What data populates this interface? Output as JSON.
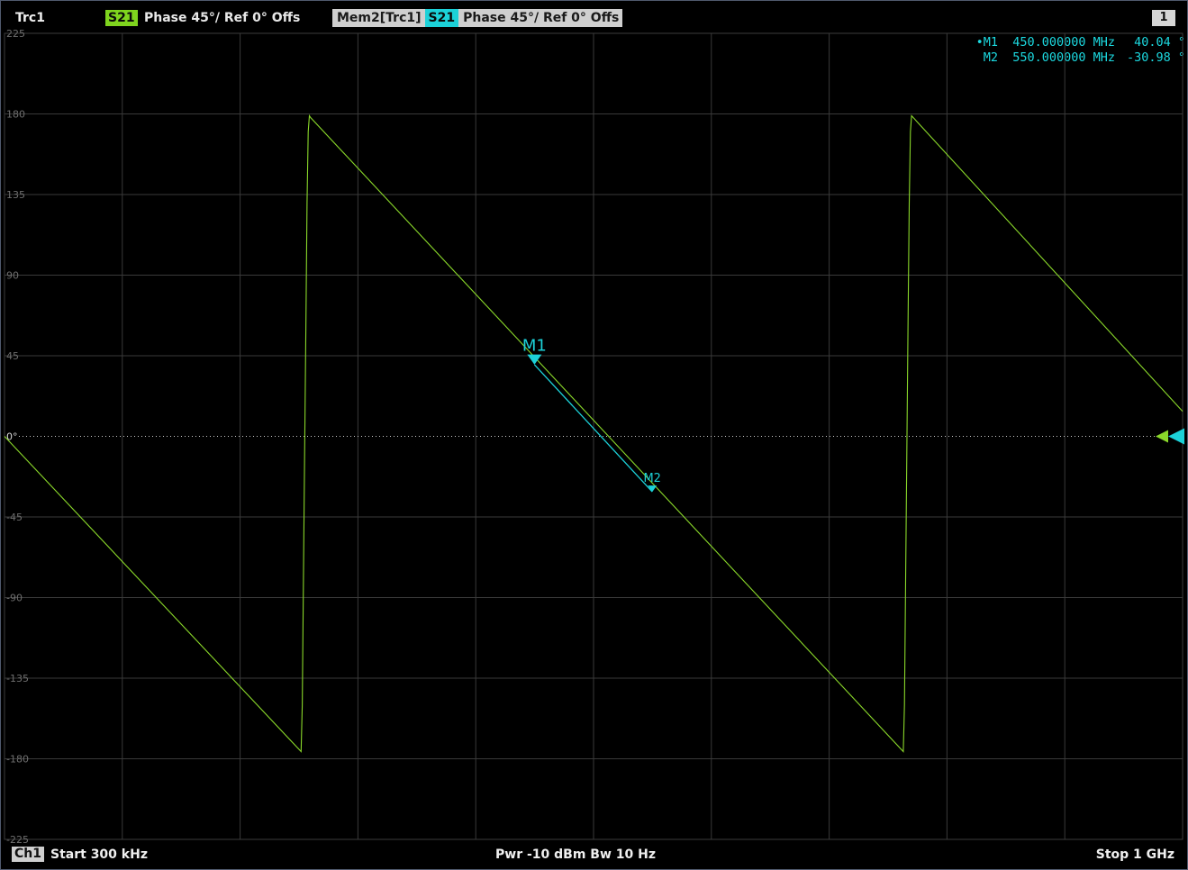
{
  "header": {
    "trace_name": "Trc1",
    "trace_param": "S21",
    "trace_desc": "Phase  45°/  Ref 0°  Offs",
    "memory_name": "Mem2[Trc1]",
    "memory_param": "S21",
    "memory_desc": "Phase  45°/  Ref 0°  Offs",
    "window_number": "1",
    "trace_color": "#7fd41e",
    "memory_color": "#1cd1d8"
  },
  "marker_table": [
    {
      "label": "•M1",
      "frequency": "450.000000 MHz",
      "value": "40.04 °"
    },
    {
      "label": "M2",
      "frequency": "550.000000 MHz",
      "value": "-30.98 °"
    }
  ],
  "footer": {
    "channel": "Ch1",
    "start": "Start  300 kHz",
    "power": "Pwr  -10 dBm  Bw  10 Hz",
    "stop": "Stop  1 GHz"
  },
  "chart_data": {
    "type": "line",
    "xlabel": "",
    "ylabel": "",
    "xlim": [
      0.3,
      1000
    ],
    "ylim": [
      -225,
      225
    ],
    "x_unit": "MHz",
    "y_unit": "°",
    "yticks": [
      225,
      180,
      135,
      90,
      45,
      0,
      -45,
      -90,
      -135,
      -180,
      -225
    ],
    "ytick_labels": [
      "225",
      "180",
      "135",
      "90",
      "45",
      "0°",
      "-45",
      "-90",
      "-135",
      "-180",
      "-225"
    ],
    "grid": true,
    "x_divisions": 10,
    "reference_level": 0,
    "series": [
      {
        "name": "Trc1",
        "color": "#8ad82a",
        "x": [
          0.3,
          252,
          253,
          254,
          255,
          256,
          257,
          258,
          259,
          260,
          763,
          764,
          765,
          766,
          767,
          768,
          769,
          770,
          1000
        ],
        "y": [
          0,
          -176,
          -150,
          -80,
          -10,
          60,
          130,
          170,
          179,
          178,
          -176,
          -150,
          -80,
          -10,
          60,
          130,
          170,
          179,
          14
        ],
        "role": "trace"
      },
      {
        "name": "Mem2[Trc1]",
        "color": "#1cd1d8",
        "x": [
          450,
          550
        ],
        "y": [
          40.04,
          -30.98
        ],
        "role": "memory"
      }
    ],
    "markers": [
      {
        "name": "M1",
        "x": 450,
        "y": 40.04,
        "active": true
      },
      {
        "name": "M2",
        "x": 550,
        "y": -30.98,
        "active": false
      }
    ]
  }
}
